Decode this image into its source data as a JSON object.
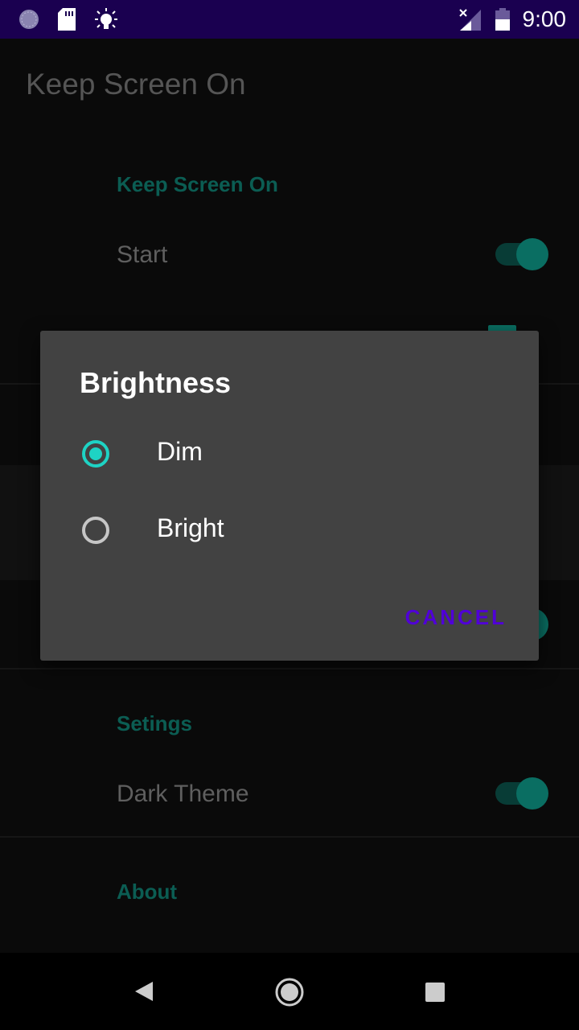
{
  "status_bar": {
    "time": "9:00",
    "icons": [
      "sync-icon",
      "sd-card-icon",
      "brightness-icon",
      "no-signal-icon",
      "battery-icon"
    ],
    "color": "#1a0050"
  },
  "app_bar": {
    "title": "Keep Screen On"
  },
  "settings": {
    "category_main": "Keep Screen On",
    "start_label": "Start",
    "start_on": true,
    "category_settings": "Setings",
    "dark_theme_label": "Dark Theme",
    "dark_theme_on": true,
    "category_about": "About"
  },
  "dialog": {
    "title": "Brightness",
    "options": [
      {
        "label": "Dim",
        "selected": true
      },
      {
        "label": "Bright",
        "selected": false
      }
    ],
    "cancel_label": "CANCEL",
    "accent": "#1ed3c4",
    "button_color": "#5000d8"
  },
  "nav_bar": {
    "icons": [
      "back-icon",
      "home-icon",
      "recents-icon"
    ]
  }
}
